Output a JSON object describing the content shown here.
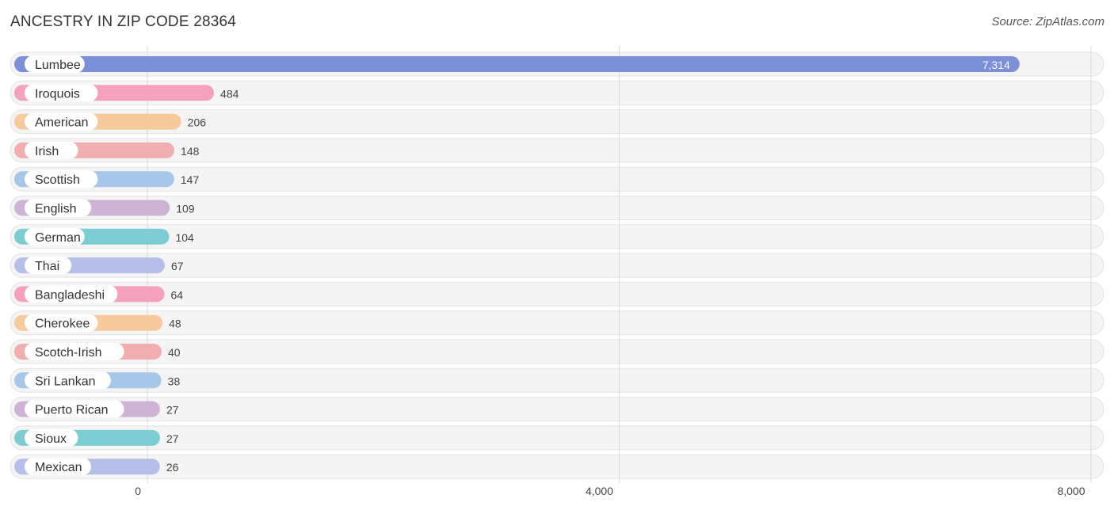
{
  "header": {
    "title": "ANCESTRY IN ZIP CODE 28364",
    "source": "Source: ZipAtlas.com"
  },
  "chart_data": {
    "type": "bar",
    "orientation": "horizontal",
    "title": "ANCESTRY IN ZIP CODE 28364",
    "xlabel": "",
    "ylabel": "",
    "xlim": [
      0,
      8000
    ],
    "grid": true,
    "xticks": [
      0,
      4000,
      8000
    ],
    "xtick_labels": [
      "0",
      "4,000",
      "8,000"
    ],
    "categories": [
      "Lumbee",
      "Iroquois",
      "American",
      "Irish",
      "Scottish",
      "English",
      "German",
      "Thai",
      "Bangladeshi",
      "Cherokee",
      "Scotch-Irish",
      "Sri Lankan",
      "Puerto Rican",
      "Sioux",
      "Mexican"
    ],
    "values": [
      7314,
      484,
      206,
      148,
      147,
      109,
      104,
      67,
      64,
      48,
      40,
      38,
      27,
      27,
      26
    ],
    "value_labels": [
      "7,314",
      "484",
      "206",
      "148",
      "147",
      "109",
      "104",
      "67",
      "64",
      "48",
      "40",
      "38",
      "27",
      "27",
      "26"
    ],
    "colors": [
      "#7b8fdb",
      "#f5a0bc",
      "#f8c99a",
      "#f0aeae",
      "#a6c6ea",
      "#ceb3d6",
      "#7ccdd1",
      "#b5bfe9",
      "#f5a0bc",
      "#f8c99a",
      "#f0aeae",
      "#a6c6ea",
      "#ceb3d6",
      "#7ccdd1",
      "#b5bfe9"
    ]
  }
}
